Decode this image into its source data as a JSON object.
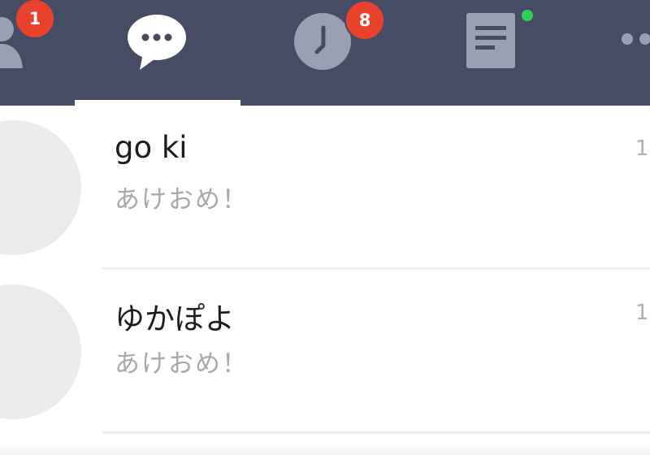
{
  "tabbar": {
    "tabs": [
      {
        "id": "friends",
        "icon": "person-icon",
        "badge": "1"
      },
      {
        "id": "chats",
        "icon": "chat-bubble-icon",
        "selected": true
      },
      {
        "id": "timeline",
        "icon": "clock-icon",
        "badge": "8"
      },
      {
        "id": "news",
        "icon": "news-icon",
        "status": "online-dot"
      },
      {
        "id": "more",
        "icon": "more-icon"
      }
    ]
  },
  "chats": [
    {
      "name": "go ki",
      "preview": "あけおめ！",
      "time": "1"
    },
    {
      "name": "ゆかぽよ",
      "preview": "あけおめ！",
      "time": "1"
    }
  ],
  "colors": {
    "tabbar_bg": "#454c63",
    "badge": "#e8412c",
    "online_dot": "#2fd05a",
    "avatar_placeholder": "#ebebeb",
    "preview_text": "#a9a9a9"
  }
}
